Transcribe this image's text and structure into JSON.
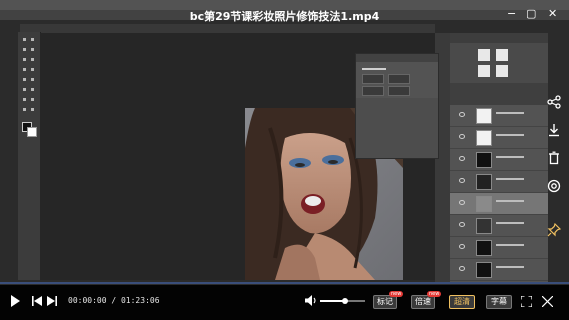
{
  "player": {
    "title": "bc第29节课彩妆照片修饰技法1.mp4",
    "current_time": "00:00:00",
    "duration": "01:23:06",
    "time_separator": " / ",
    "buttons": {
      "notes": "标记",
      "speed": "倍速",
      "quality": "超清",
      "subtitle": "字幕"
    },
    "badges": {
      "notes": "new",
      "speed": "new"
    },
    "volume_level": 0.55,
    "progress": 0.0,
    "colors": {
      "accent_quality": "#f0c060",
      "progress_track": "#3a4e7a",
      "badge": "#e53935"
    }
  },
  "window_controls": [
    "−",
    "▢",
    "✕"
  ],
  "sidebar_actions": [
    "share",
    "download",
    "delete",
    "record",
    "pin"
  ]
}
